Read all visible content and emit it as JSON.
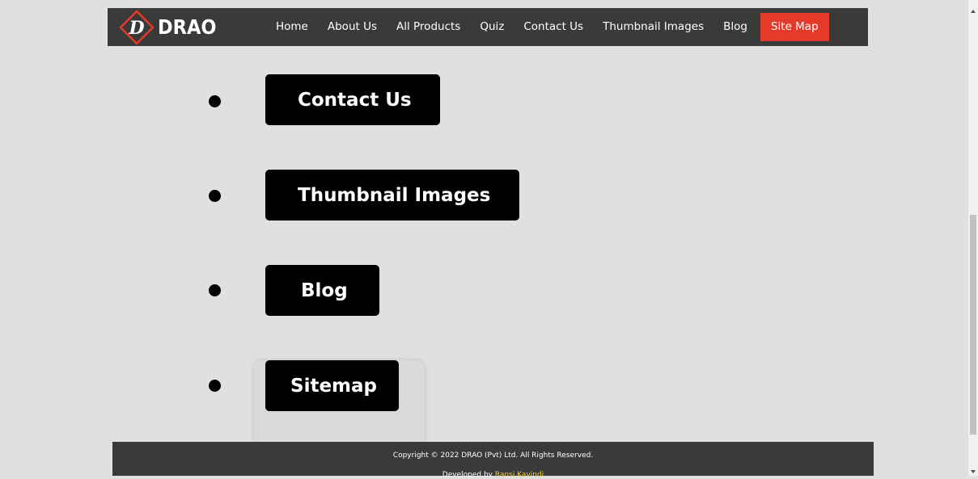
{
  "brand": {
    "name": "DRAO",
    "logo_letter": "D"
  },
  "nav": {
    "links": [
      "Home",
      "About Us",
      "All Products",
      "Quiz",
      "Contact Us",
      "Thumbnail Images",
      "Blog"
    ],
    "active": "Site Map"
  },
  "sitemap": {
    "items": [
      "Contact Us",
      "Thumbnail Images",
      "Blog",
      "Sitemap"
    ]
  },
  "footer": {
    "copyright": "Copyright © 2022 DRAO (Pvt) Ltd. All Rights Reserved.",
    "developed_prefix": "Developed by ",
    "developer": "Ransi Kavindi"
  },
  "colors": {
    "nav_bg": "#3a3a3a",
    "accent": "#e53a29",
    "page_bg": "#e0e0e0"
  }
}
